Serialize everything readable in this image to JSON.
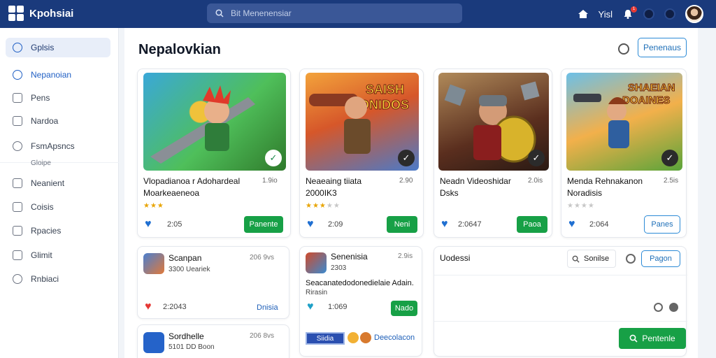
{
  "header": {
    "app_name": "Kpohsiai",
    "search_placeholder": "Bit Menenensiar",
    "user_label": "Yisl",
    "notification_count": "1"
  },
  "sidebar": {
    "items": [
      {
        "label": "Gplsis",
        "icon": "gear-icon"
      },
      {
        "label": "Nepanoian",
        "icon": "circle-icon"
      },
      {
        "label": "Pens",
        "icon": "bookmark-icon"
      },
      {
        "label": "Nardoa",
        "icon": "check-square-icon"
      },
      {
        "label": "FsmApsncs",
        "icon": "tag-icon"
      },
      {
        "label": "Neanient",
        "icon": "edit-icon"
      },
      {
        "label": "Coisis",
        "icon": "grid-icon"
      },
      {
        "label": "Rpacies",
        "icon": "document-icon"
      },
      {
        "label": "Glimit",
        "icon": "clipboard-icon"
      },
      {
        "label": "Rnbiaci",
        "icon": "settings-icon"
      }
    ],
    "subtext": "Gloipe"
  },
  "main": {
    "title": "Nepalovkian",
    "top_button": "Penenaus",
    "games": [
      {
        "title": "Vlopadianoa r Adohardeal",
        "subtitle": "Moarkeaeneoa",
        "size": "1.9io",
        "rating": 3,
        "count": "2:05",
        "button": "Panente",
        "button_style": "green"
      },
      {
        "title": "Neaeaing tiiata",
        "subtitle": "2000IK3",
        "size": "2.90",
        "rating": 3,
        "count": "2:09",
        "button": "Neni",
        "button_style": "green"
      },
      {
        "title": "Neadn Videoshidar",
        "subtitle": "Dsks",
        "size": "2.0is",
        "rating": 0,
        "count": "2:0647",
        "button": "Paoa",
        "button_style": "green"
      },
      {
        "title": "Menda Rehnakanon",
        "subtitle": "Noradisis",
        "size": "2.5is",
        "rating": 0,
        "count": "2:064",
        "button": "Panes",
        "button_style": "outline"
      }
    ],
    "list_card_1": {
      "rows": [
        {
          "title": "Scanpan",
          "sub": "3300 Ueariek",
          "size": "206 9vs"
        },
        {
          "title": "Sordhelle",
          "sub": "5101 DD Boon",
          "size": "206 8vs"
        }
      ],
      "count": "2:2043",
      "link": "Dnisia"
    },
    "list_card_2": {
      "title": "Senenisia",
      "sub": "2303",
      "size": "2.9is",
      "desc": "Seacanatedodonedielaie Adain.",
      "desc2": "Rirasin",
      "count": "1:069",
      "button": "Nado",
      "tag": "Siidia",
      "footer_link": "Deecolacon"
    },
    "panel": {
      "title": "Uodessi",
      "filter_label": "Sonilse",
      "button": "Pagon",
      "green_button": "Pentenle"
    }
  },
  "colors": {
    "topbar": "#1a3a7c",
    "accent_blue": "#1e6fb8",
    "green": "#17a046"
  }
}
